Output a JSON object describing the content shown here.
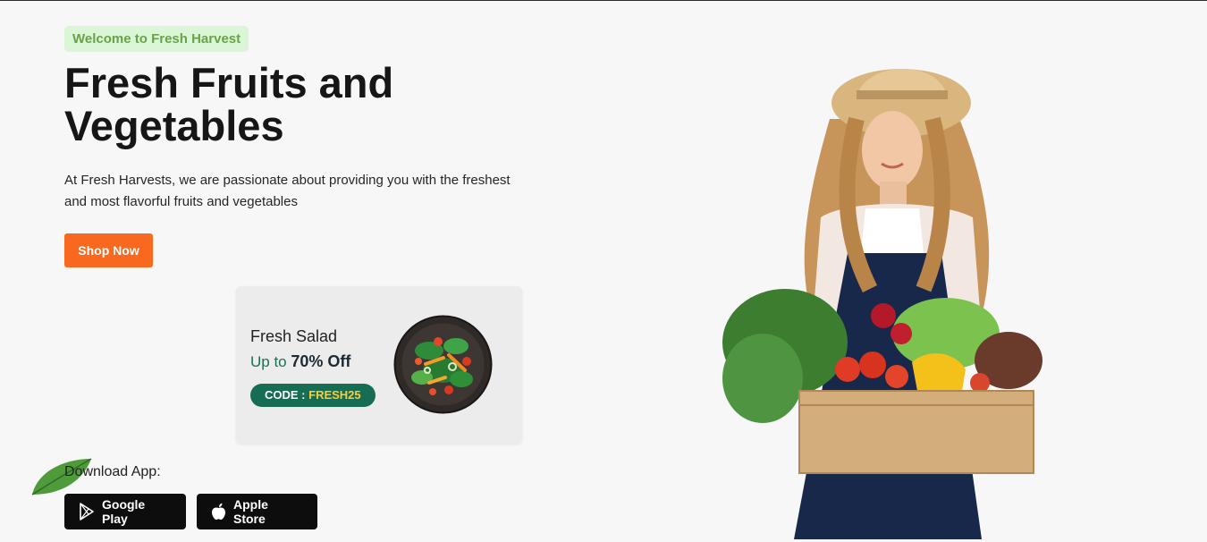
{
  "hero": {
    "badge": "Welcome to Fresh Harvest",
    "title": "Fresh Fruits and Vegetables",
    "description": "At Fresh Harvests, we are passionate about providing you with the freshest and most flavorful fruits and vegetables",
    "cta": "Shop Now"
  },
  "promo": {
    "title": "Fresh Salad",
    "discount_prefix": "Up to",
    "discount_value": "70% Off",
    "code_label": "CODE :",
    "code_value": "FRESH25"
  },
  "download": {
    "label": "Download App:",
    "google_play": "Google Play",
    "apple_store": "Apple Store"
  },
  "colors": {
    "accent_orange": "#f8681e",
    "brand_green": "#176d53",
    "badge_bg": "#daf6d6",
    "badge_text": "#6aa247",
    "code_yellow": "#ffcc33"
  },
  "icons": [
    "leaf-icon",
    "google-play-icon",
    "apple-icon"
  ]
}
